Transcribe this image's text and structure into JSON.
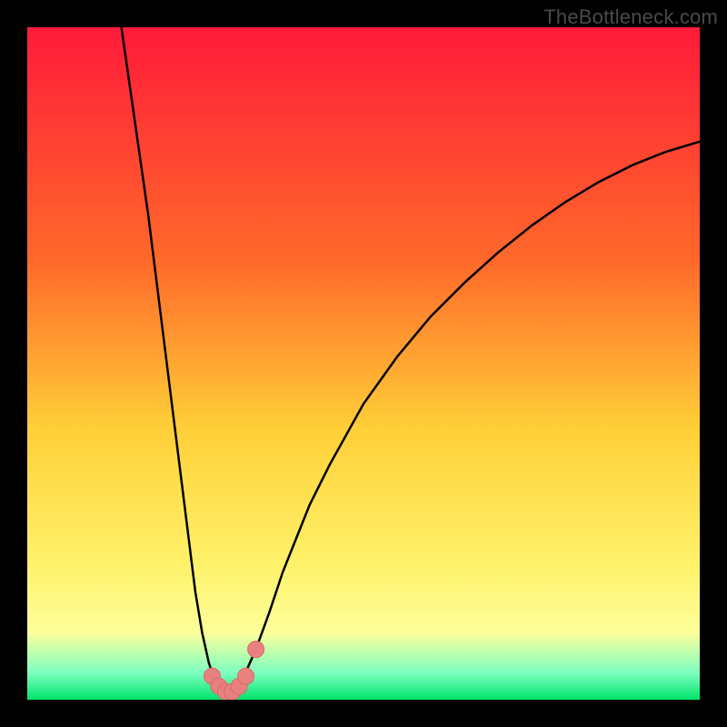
{
  "watermark": "TheBottleneck.com",
  "colors": {
    "bg_black": "#000000",
    "curve": "#000000",
    "marker_fill": "#e98080",
    "marker_stroke": "#d86a6a",
    "grad_top": "#ff1a3a",
    "grad_mid1": "#ff6a2a",
    "grad_mid2": "#ffd038",
    "grad_yellow": "#fff26b",
    "grad_lightyellow": "#fdff9a",
    "grad_green1": "#7dffc0",
    "grad_green2": "#00e56a"
  },
  "chart_data": {
    "type": "line",
    "title": "",
    "xlabel": "",
    "ylabel": "",
    "xlim": [
      0,
      100
    ],
    "ylim": [
      0,
      100
    ],
    "series": [
      {
        "name": "bottleneck-curve",
        "x": [
          14,
          15,
          16,
          17,
          18,
          19,
          20,
          21,
          22,
          23,
          24,
          25,
          26,
          27,
          28,
          29,
          30,
          31,
          32,
          34,
          36,
          38,
          40,
          42,
          45,
          50,
          55,
          60,
          65,
          70,
          75,
          80,
          85,
          90,
          95,
          100
        ],
        "y": [
          100,
          93,
          86,
          79,
          72,
          64,
          56,
          48,
          40,
          32,
          24,
          16,
          10,
          5.5,
          2.5,
          1.2,
          1.0,
          1.5,
          3.0,
          7.5,
          13,
          19,
          24,
          29,
          35,
          44,
          51,
          57,
          62,
          66.5,
          70.5,
          74,
          77,
          79.5,
          81.5,
          83
        ]
      }
    ],
    "markers": {
      "name": "highlight-points",
      "x": [
        27.5,
        28.5,
        29.5,
        30.5,
        31.5,
        32.5,
        34.0
      ],
      "y": [
        3.5,
        2.0,
        1.2,
        1.2,
        2.0,
        3.5,
        7.5
      ]
    },
    "gradient_stops": [
      {
        "offset": 0.0,
        "color": "#ff1a3a"
      },
      {
        "offset": 0.35,
        "color": "#ff6a2a"
      },
      {
        "offset": 0.6,
        "color": "#ffd038"
      },
      {
        "offset": 0.8,
        "color": "#fff26b"
      },
      {
        "offset": 0.9,
        "color": "#fdff9a"
      },
      {
        "offset": 0.96,
        "color": "#7dffc0"
      },
      {
        "offset": 1.0,
        "color": "#00e56a"
      }
    ]
  }
}
